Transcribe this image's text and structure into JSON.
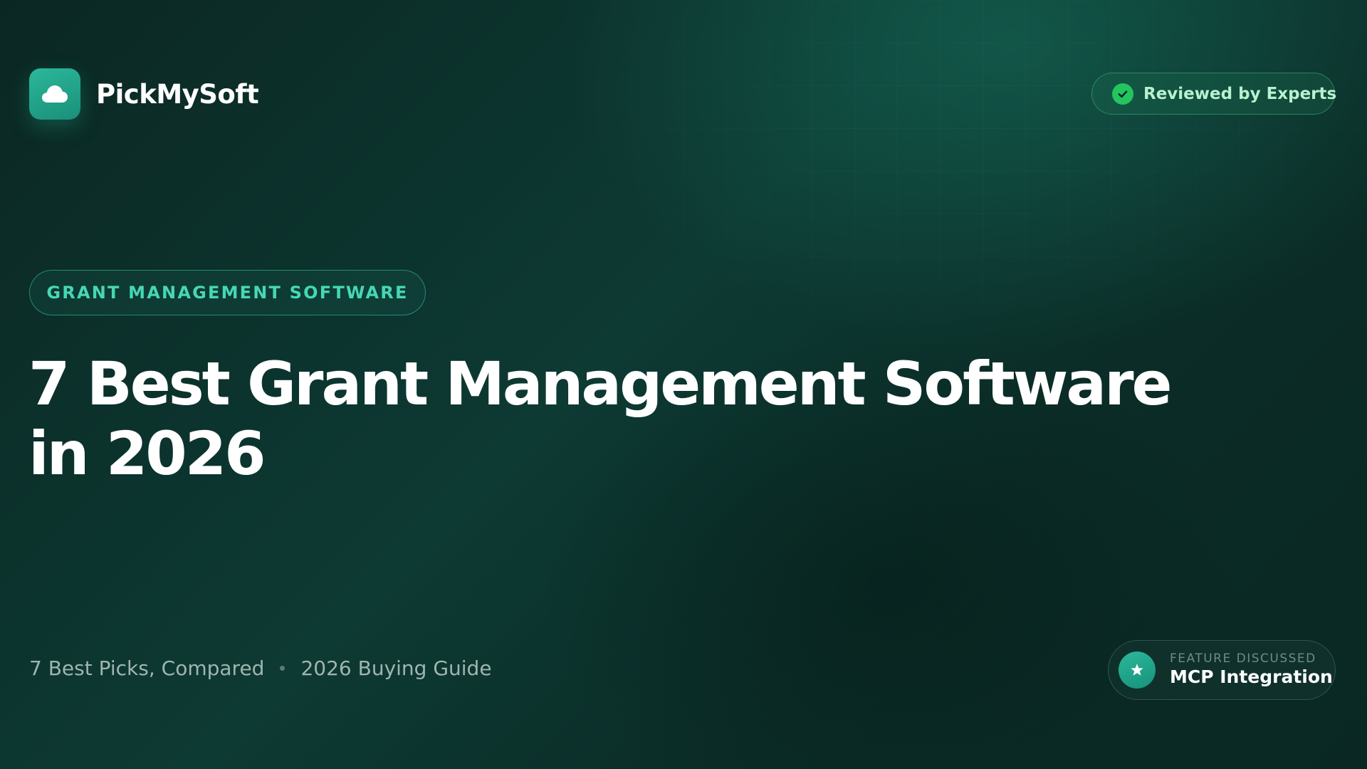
{
  "brand": {
    "name": "PickMySoft",
    "logo_icon": "cloud-icon",
    "logo_color": "#22a68c"
  },
  "badge": {
    "text": "Reviewed by Experts",
    "icon": "check-circle-icon",
    "icon_color": "#22c55e"
  },
  "category": {
    "label": "GRANT MANAGEMENT SOFTWARE",
    "color": "#46d7b4"
  },
  "title": {
    "line1": "7 Best Grant Management Software",
    "line2": "in 2026"
  },
  "meta": {
    "items": [
      "7 Best Picks, Compared",
      "2026 Buying Guide"
    ]
  },
  "feature": {
    "label": "FEATURE DISCUSSED",
    "value": "MCP Integration",
    "icon": "star-icon"
  }
}
